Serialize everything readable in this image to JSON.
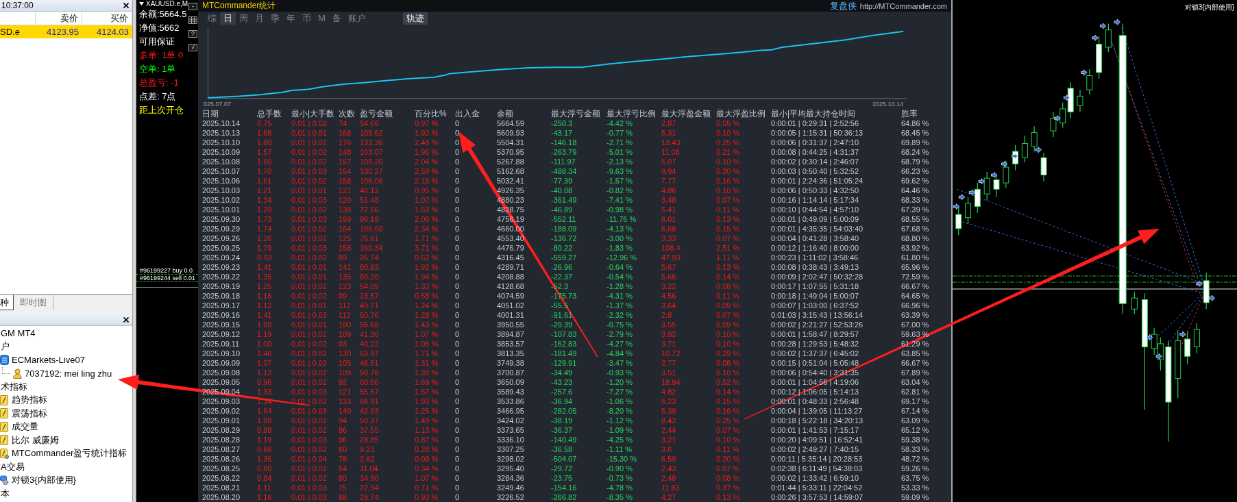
{
  "market_watch": {
    "time": "10:37:00",
    "columns": [
      "卖价",
      "买价"
    ],
    "rows": [
      {
        "symbol": "SD.e",
        "bid": "4123.95",
        "ask": "4124.03",
        "selected": true
      }
    ],
    "tabs": [
      {
        "label": "种",
        "selected": true
      },
      {
        "label": "即时图",
        "selected": false
      }
    ]
  },
  "navigator": {
    "items": [
      {
        "label": "GM MT4"
      },
      {
        "label": "户",
        "children": [
          {
            "label": "ECMarkets-Live07",
            "kind": "server",
            "children": [
              {
                "label": "7037192: mei ling zhu",
                "kind": "account"
              }
            ]
          }
        ]
      },
      {
        "label": "术指标",
        "children": [
          {
            "label": "趋势指标",
            "kind": "indicator"
          },
          {
            "label": "震荡指标",
            "kind": "indicator"
          },
          {
            "label": "成交量",
            "kind": "indicator"
          },
          {
            "label": "比尔 威廉姆",
            "kind": "indicator"
          },
          {
            "label": "MTCommander盈亏统计指标",
            "kind": "custom_indicator"
          }
        ]
      },
      {
        "label": "A交易",
        "children": [
          {
            "label": "对锁3{内部使用}",
            "kind": "expert"
          }
        ]
      },
      {
        "label": "本"
      }
    ]
  },
  "chart": {
    "title": "XAUUSD.e,M",
    "tool_buttons": [
      {
        "kind": "text",
        "label": "-"
      },
      {
        "kind": "grid"
      },
      {
        "kind": "text",
        "label": "?"
      },
      {
        "kind": "text",
        "label": "√"
      }
    ],
    "info_lines": [
      {
        "text": "余额:5664.5",
        "color": "#ffffff"
      },
      {
        "text": "净值:5662",
        "color": "#ffffff"
      },
      {
        "text": "可用保证",
        "color": "#ffffff"
      },
      {
        "text": "多单: 1单 0",
        "color": "#ff1a1a"
      },
      {
        "text": "空单: 1单",
        "color": "#00ff00"
      },
      {
        "text": "总盈亏: -1",
        "color": "#ff1a1a"
      },
      {
        "text": "点差: 7点",
        "color": "#ffffff"
      },
      {
        "text": "距上次开仓",
        "color": "#ffff00"
      }
    ],
    "orders": [
      "#96199227 buy 0.0",
      "#96199244 sell 0.01"
    ],
    "ea_label": "对锁3{内部使用}"
  },
  "stats_window": {
    "title": "MTCommander统计",
    "brand": "复盘侠",
    "url": "http://MTCommander.com",
    "tabs": [
      {
        "label": "综",
        "selected": false
      },
      {
        "label": "日",
        "selected": true
      },
      {
        "label": "周",
        "selected": false
      },
      {
        "label": "月",
        "selected": false
      },
      {
        "label": "季",
        "selected": false
      },
      {
        "label": "年",
        "selected": false
      },
      {
        "label": "币",
        "selected": false
      },
      {
        "label": "M",
        "selected": false
      },
      {
        "label": "备",
        "selected": false
      },
      {
        "label": "账户",
        "selected": false
      }
    ],
    "view_button": {
      "label": "轨迹",
      "selected": true
    },
    "equity_chart": {
      "start_label": "025.07.07",
      "end_label": "2025.10.14"
    },
    "table": {
      "columns": [
        {
          "label": "日期",
          "kind": "plain"
        },
        {
          "label": "总手数",
          "kind": "stat"
        },
        {
          "label": "最小|大手数",
          "kind": "stat"
        },
        {
          "label": "次数",
          "kind": "stat"
        },
        {
          "label": "盈亏金额",
          "kind": "stat"
        },
        {
          "label": "百分比%",
          "kind": "stat"
        },
        {
          "label": "出入金",
          "kind": "plain"
        },
        {
          "label": "余额",
          "kind": "plain"
        },
        {
          "label": "最大浮亏金额",
          "kind": "drawdown"
        },
        {
          "label": "最大浮亏比例",
          "kind": "drawdown"
        },
        {
          "label": "最大浮盈金额",
          "kind": "stat"
        },
        {
          "label": "最大浮盈比例",
          "kind": "stat"
        },
        {
          "label": "最小|平均最大持仓时间",
          "kind": "plain"
        },
        {
          "label": "胜率",
          "kind": "plain"
        }
      ],
      "rows": [
        [
          "2025.10.14",
          "0.75",
          "0.01 | 0.02",
          "74",
          "54.66",
          "0.97 %",
          "0",
          "5664.59",
          "-250.3",
          "-4.42 %",
          "2.87",
          "0.05 %",
          "0:00:01 | 0:29:31 | 2:52:56",
          "64.86 %"
        ],
        [
          "2025.10.13",
          "1.68",
          "0.01 | 0.01",
          "168",
          "105.62",
          "1.92 %",
          "0",
          "5609.93",
          "-43.17",
          "-0.77 %",
          "5.31",
          "0.10 %",
          "0:00:05 | 1:15:31 | 50:36:13",
          "68.45 %"
        ],
        [
          "2025.10.10",
          "1.80",
          "0.01 | 0.02",
          "176",
          "133.36",
          "2.48 %",
          "0",
          "5504.31",
          "-146.18",
          "-2.71 %",
          "13.43",
          "0.25 %",
          "0:00:06 | 0:31:37 | 2:47:10",
          "69.89 %"
        ],
        [
          "2025.10.09",
          "1.57",
          "0.01 | 0.02",
          "148",
          "103.07",
          "1.96 %",
          "0",
          "5370.95",
          "-263.79",
          "-5.01 %",
          "11.08",
          "0.21 %",
          "0:00:08 | 0:44:25 | 4:31:37",
          "68.24 %"
        ],
        [
          "2025.10.08",
          "1.60",
          "0.01 | 0.02",
          "157",
          "105.20",
          "2.04 %",
          "0",
          "5267.88",
          "-111.97",
          "-2.13 %",
          "5.07",
          "0.10 %",
          "0:00:02 | 0:30:14 | 2:46:07",
          "68.79 %"
        ],
        [
          "2025.10.07",
          "1.70",
          "0.01 | 0.03",
          "154",
          "130.27",
          "2.59 %",
          "0",
          "5162.68",
          "-488.34",
          "-9.63 %",
          "9.94",
          "0.20 %",
          "0:00:03 | 0:50:40 | 5:32:52",
          "66.23 %"
        ],
        [
          "2025.10.06",
          "1.61",
          "0.01 | 0.02",
          "158",
          "106.06",
          "2.15 %",
          "0",
          "5032.41",
          "-77.39",
          "-1.57 %",
          "7.77",
          "0.16 %",
          "0:00:01 | 2:24:36 | 51:05:24",
          "69.62 %"
        ],
        [
          "2025.10.03",
          "1.21",
          "0.01 | 0.01",
          "121",
          "46.12",
          "0.95 %",
          "0",
          "4926.35",
          "-40.08",
          "-0.82 %",
          "4.86",
          "0.10 %",
          "0:00:06 | 0:50:33 | 4:32:50",
          "64.46 %"
        ],
        [
          "2025.10.02",
          "1.34",
          "0.01 | 0.03",
          "120",
          "51.48",
          "1.07 %",
          "0",
          "4880.23",
          "-361.49",
          "-7.41 %",
          "3.48",
          "0.07 %",
          "0:00:16 | 1:14:14 | 5:17:34",
          "68.33 %"
        ],
        [
          "2025.10.01",
          "1.39",
          "0.01 | 0.02",
          "138",
          "72.56",
          "1.53 %",
          "0",
          "4828.75",
          "-46.89",
          "-0.98 %",
          "5.41",
          "0.11 %",
          "0:00:10 | 0:44:54 | 4:57:10",
          "67.39 %"
        ],
        [
          "2025.09.30",
          "1.73",
          "0.01 | 0.03",
          "159",
          "96.19",
          "2.06 %",
          "0",
          "4756.19",
          "-552.11",
          "-11.76 %",
          "6.01",
          "0.13 %",
          "0:00:01 | 0:49:09 | 5:00:09",
          "68.55 %"
        ],
        [
          "2025.09.29",
          "1.74",
          "0.01 | 0.02",
          "164",
          "106.60",
          "2.34 %",
          "0",
          "4660.00",
          "-188.09",
          "-4.13 %",
          "6.68",
          "0.15 %",
          "0:00:01 | 4:35:35 | 54:03:40",
          "67.68 %"
        ],
        [
          "2025.09.26",
          "1.26",
          "0.01 | 0.02",
          "125",
          "76.61",
          "1.71 %",
          "0",
          "4553.40",
          "-136.72",
          "-3.00 %",
          "3.33",
          "0.07 %",
          "0:00:04 | 0:41:28 | 3:58:40",
          "68.80 %"
        ],
        [
          "2025.09.25",
          "1.79",
          "0.01 | 0.03",
          "158",
          "160.34",
          "3.71 %",
          "0",
          "4476.79",
          "-80.22",
          "-1.83 %",
          "108.4",
          "2.51 %",
          "0:00:12 | 1:16:40 | 8:00:00",
          "63.92 %"
        ],
        [
          "2025.09.24",
          "0.93",
          "0.01 | 0.02",
          "89",
          "26.74",
          "0.62 %",
          "0",
          "4316.45",
          "-559.27",
          "-12.96 %",
          "47.93",
          "1.11 %",
          "0:00:23 | 1:11:02 | 3:58:46",
          "61.80 %"
        ],
        [
          "2025.09.23",
          "1.41",
          "0.01 | 0.01",
          "141",
          "80.83",
          "1.92 %",
          "0",
          "4289.71",
          "-26.96",
          "-0.64 %",
          "5.67",
          "0.13 %",
          "0:00:08 | 0:38:43 | 3:49:13",
          "65.96 %"
        ],
        [
          "2025.09.22",
          "1.35",
          "0.01 | 0.01",
          "135",
          "80.20",
          "1.94 %",
          "0",
          "4208.88",
          "-22.37",
          "-0.54 %",
          "5.66",
          "0.14 %",
          "0:00:09 | 2:02:47 | 50:32:28",
          "72.59 %"
        ],
        [
          "2025.09.19",
          "1.25",
          "0.01 | 0.02",
          "123",
          "54.09",
          "1.33 %",
          "0",
          "4128.68",
          "-52.3",
          "-1.28 %",
          "3.22",
          "0.08 %",
          "0:00:17 | 1:07:55 | 5:31:18",
          "66.67 %"
        ],
        [
          "2025.09.18",
          "1.16",
          "0.01 | 0.02",
          "99",
          "23.57",
          "0.58 %",
          "0",
          "4074.59",
          "-175.73",
          "-4.31 %",
          "4.56",
          "0.11 %",
          "0:00:18 | 1:49:04 | 5:00:07",
          "64.65 %"
        ],
        [
          "2025.09.17",
          "1.12",
          "0.01 | 0.01",
          "112",
          "49.71",
          "1.24 %",
          "0",
          "4051.02",
          "-55.5",
          "-1.37 %",
          "3.64",
          "0.09 %",
          "0:00:07 | 1:03:00 | 6:37:52",
          "66.96 %"
        ],
        [
          "2025.09.16",
          "1.41",
          "0.01 | 0.03",
          "112",
          "50.76",
          "1.28 %",
          "0",
          "4001.31",
          "-91.61",
          "-2.32 %",
          "2.8",
          "0.07 %",
          "0:01:03 | 3:15:43 | 13:56:14",
          "63.39 %"
        ],
        [
          "2025.09.15",
          "1.00",
          "0.01 | 0.01",
          "100",
          "55.68",
          "1.43 %",
          "0",
          "3950.55",
          "-29.39",
          "-0.75 %",
          "3.55",
          "0.09 %",
          "0:00:02 | 2:21:27 | 52:53:26",
          "67.00 %"
        ],
        [
          "2025.09.12",
          "1.19",
          "0.01 | 0.02",
          "109",
          "41.30",
          "1.07 %",
          "0",
          "3894.87",
          "-107.83",
          "-2.79 %",
          "3.92",
          "0.10 %",
          "0:00:01 | 1:58:47 | 8:29:57",
          "59.63 %"
        ],
        [
          "2025.09.11",
          "1.00",
          "0.01 | 0.02",
          "93",
          "40.22",
          "1.05 %",
          "0",
          "3853.57",
          "-162.83",
          "-4.27 %",
          "3.71",
          "0.10 %",
          "0:00:28 | 1:29:53 | 5:48:32",
          "61.29 %"
        ],
        [
          "2025.09.10",
          "1.46",
          "0.01 | 0.02",
          "130",
          "63.97",
          "1.71 %",
          "0",
          "3813.35",
          "-181.49",
          "-4.84 %",
          "10.72",
          "0.29 %",
          "0:00:02 | 1:37:37 | 6:45:02",
          "63.85 %"
        ],
        [
          "2025.09.09",
          "1.07",
          "0.01 | 0.02",
          "105",
          "48.51",
          "1.31 %",
          "0",
          "3749.38",
          "-129.91",
          "-3.47 %",
          "2.77",
          "0.08 %",
          "0:00:15 | 0:51:04 | 5:05:48",
          "66.67 %"
        ],
        [
          "2025.09.08",
          "1.12",
          "0.01 | 0.02",
          "109",
          "50.78",
          "1.39 %",
          "0",
          "3700.87",
          "-34.49",
          "-0.93 %",
          "3.51",
          "0.10 %",
          "0:00:06 | 0:54:40 | 3:31:35",
          "67.89 %"
        ],
        [
          "2025.09.05",
          "0.96",
          "0.01 | 0.02",
          "92",
          "60.66",
          "1.69 %",
          "0",
          "3650.09",
          "-43.23",
          "-1.20 %",
          "18.94",
          "0.52 %",
          "0:00:01 | 1:04:56 | 4:19:06",
          "63.04 %"
        ],
        [
          "2025.09.04",
          "1.33",
          "0.01 | 0.03",
          "121",
          "55.57",
          "1.57 %",
          "0",
          "3589.43",
          "-257.6",
          "-7.27 %",
          "4.82",
          "0.14 %",
          "0:00:12 | 1:06:05 | 5:14:13",
          "62.81 %"
        ],
        [
          "2025.09.03",
          "1.34",
          "0.01 | 0.02",
          "133",
          "66.91",
          "1.93 %",
          "0",
          "3533.86",
          "-36.94",
          "-1.06 %",
          "5.23",
          "0.15 %",
          "0:00:01 | 0:48:33 | 2:56:48",
          "69.17 %"
        ],
        [
          "2025.09.02",
          "1.64",
          "0.01 | 0.03",
          "140",
          "42.93",
          "1.25 %",
          "0",
          "3466.95",
          "-282.05",
          "-8.20 %",
          "5.39",
          "0.16 %",
          "0:00:04 | 1:39:05 | 11:13:27",
          "67.14 %"
        ],
        [
          "2025.09.01",
          "1.00",
          "0.01 | 0.02",
          "94",
          "50.37",
          "1.49 %",
          "0",
          "3424.02",
          "-38.19",
          "-1.12 %",
          "8.42",
          "0.25 %",
          "0:00:18 | 5:22:18 | 34:20:13",
          "63.09 %"
        ],
        [
          "2025.08.29",
          "0.88",
          "0.01 | 0.02",
          "86",
          "37.55",
          "1.13 %",
          "0",
          "3373.65",
          "-36.37",
          "-1.09 %",
          "2.44",
          "0.07 %",
          "0:00:01 | 1:41:53 | 7:15:17",
          "65.12 %"
        ],
        [
          "2025.08.28",
          "1.19",
          "0.01 | 0.03",
          "96",
          "28.85",
          "0.87 %",
          "0",
          "3336.10",
          "-140.49",
          "-4.25 %",
          "3.21",
          "0.10 %",
          "0:00:20 | 4:09:51 | 16:52:41",
          "59.38 %"
        ],
        [
          "2025.08.27",
          "0.66",
          "0.01 | 0.02",
          "60",
          "9.23",
          "0.28 %",
          "0",
          "3307.25",
          "-36.58",
          "-1.11 %",
          "3.6",
          "0.11 %",
          "0:00:02 | 2:49:27 | 7:40:15",
          "58.33 %"
        ],
        [
          "2025.08.26",
          "1.36",
          "0.01 | 0.04",
          "78",
          "2.62",
          "0.08 %",
          "0",
          "3298.02",
          "-504.07",
          "-15.30 %",
          "6.59",
          "0.20 %",
          "0:00:11 | 5:35:14 | 20:28:53",
          "48.72 %"
        ],
        [
          "2025.08.25",
          "0.60",
          "0.01 | 0.02",
          "54",
          "11.04",
          "0.34 %",
          "0",
          "3295.40",
          "-29.72",
          "-0.90 %",
          "2.43",
          "0.07 %",
          "0:02:38 | 6:11:49 | 54:38:03",
          "59.26 %"
        ],
        [
          "2025.08.22",
          "0.84",
          "0.01 | 0.02",
          "80",
          "34.90",
          "1.07 %",
          "0",
          "3284.36",
          "-23.75",
          "-0.73 %",
          "2.48",
          "0.08 %",
          "0:00:02 | 1:33:42 | 6:59:10",
          "63.75 %"
        ],
        [
          "2025.08.21",
          "1.11",
          "0.01 | 0.03",
          "75",
          "22.94",
          "0.71 %",
          "0",
          "3249.46",
          "-154.16",
          "-4.78 %",
          "11.83",
          "0.37 %",
          "0:01:44 | 5:33:11 | 22:04:52",
          "53.33 %"
        ],
        [
          "2025.08.20",
          "1.16",
          "0.01 | 0.03",
          "88",
          "29.74",
          "0.93 %",
          "0",
          "3226.52",
          "-266.82",
          "-8.35 %",
          "4.27",
          "0.13 %",
          "0:00:26 | 3:57:53 | 14:59:07",
          "59.09 %"
        ]
      ]
    }
  }
}
